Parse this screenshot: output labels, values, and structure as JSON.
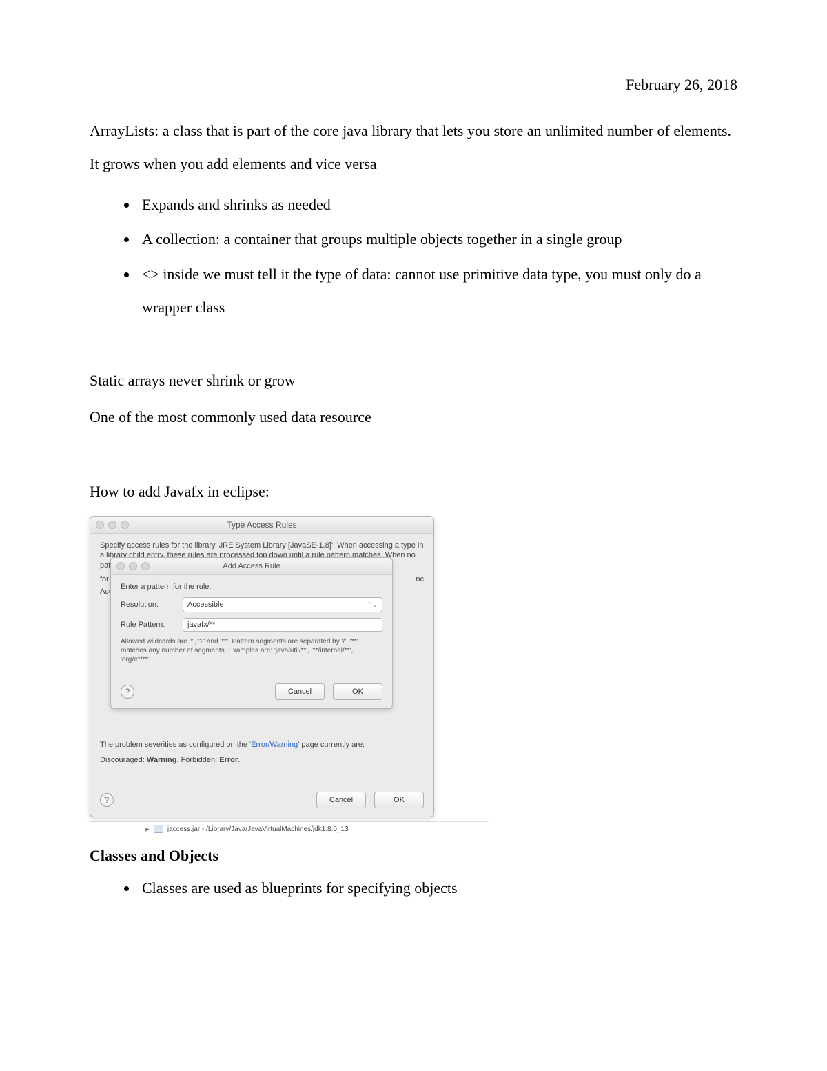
{
  "date": "February 26, 2018",
  "intro": "ArrayLists: a class that is part of the core java library that lets you store an unlimited number of elements. It grows when you add elements and vice versa",
  "bullets1": [
    "Expands and shrinks as needed",
    "A collection: a container that groups multiple objects together in a single group",
    "<> inside we must tell it the type of data: cannot use primitive data type, you must only do a wrapper class"
  ],
  "static_line": "Static arrays never shrink or grow",
  "common_line": "One of the most commonly used data resource",
  "howto": "How to add Javafx in eclipse:",
  "dialog": {
    "outer_title": "Type Access Rules",
    "outer_desc": "Specify access rules for the library 'JRE System Library [JavaSE-1.8]'. When accessing a type in a library child entry, these rules are processed top down until a rule pattern matches. When no pattern matches, the rules defined for",
    "outer_desc_cut_left": "for",
    "outer_acc_cut": "Acc",
    "outer_right_cut": "nc",
    "inner_title": "Add Access Rule",
    "enter_pattern": "Enter a pattern for the rule.",
    "resolution_label": "Resolution:",
    "resolution_value": "Accessible",
    "rule_pattern_label": "Rule Pattern:",
    "rule_pattern_value": "javafx/**",
    "allowed": "Allowed wildcards are '*', '?' and '**'. Pattern segments are separated by '/'. '**' matches any number of segments. Examples are: 'java/util/**', '**/internal/**', 'org/e*/**'.",
    "cancel": "Cancel",
    "ok": "OK",
    "severities_pre": "The problem severities as configured on the '",
    "severities_link": "Error/Warning",
    "severities_post": "' page currently are:",
    "sev_line_pre": "Discouraged: ",
    "sev_warning": "Warning",
    "sev_mid": ". Forbidden: ",
    "sev_error": "Error",
    "sev_end": ".",
    "jar_line": "jaccess.jar - /Library/Java/JavaVirtualMachines/jdk1.8.0_13"
  },
  "section_heading": "Classes and Objects",
  "bullets2": [
    "Classes are used as blueprints for specifying objects"
  ]
}
